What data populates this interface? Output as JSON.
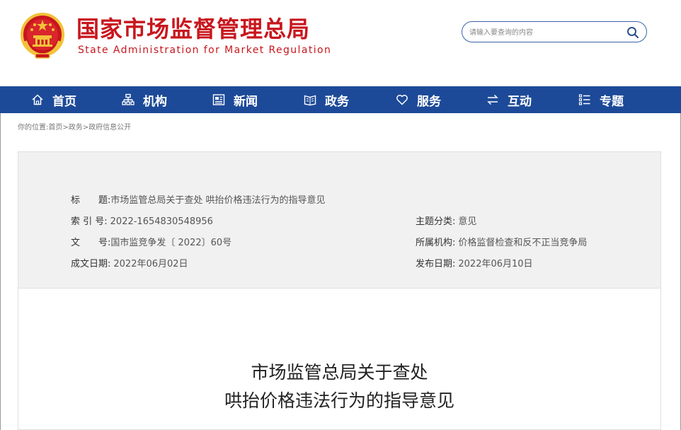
{
  "header": {
    "title": "国家市场监督管理总局",
    "subtitle": "State Administration for Market Regulation",
    "search": {
      "placeholder": "请输入要查询的内容"
    }
  },
  "nav": {
    "items": [
      {
        "label": "首页",
        "icon": "home-icon"
      },
      {
        "label": "机构",
        "icon": "org-chart-icon"
      },
      {
        "label": "新闻",
        "icon": "newspaper-icon"
      },
      {
        "label": "政务",
        "icon": "open-book-icon"
      },
      {
        "label": "服务",
        "icon": "heart-icon"
      },
      {
        "label": "互动",
        "icon": "exchange-arrows-icon"
      },
      {
        "label": "专题",
        "icon": "list-icon"
      }
    ]
  },
  "breadcrumb": {
    "prefix": "你的位置:",
    "items": [
      "首页",
      "政务",
      "政府信息公开"
    ],
    "separator": ">"
  },
  "meta": {
    "title_label": "标　　题:",
    "title_value": "市场监管总局关于查处 哄抬价格违法行为的指导意见",
    "index_label": "索 引 号:",
    "index_value": "2022-1654830548956",
    "category_label": "主题分类:",
    "category_value": "意见",
    "doc_no_label": "文　　号:",
    "doc_no_value": "国市监竞争发〔 2022〕60号",
    "agency_label": "所属机构:",
    "agency_value": "价格监督检查和反不正当竞争局",
    "created_label": "成文日期:",
    "created_value": "2022年06月02日",
    "published_label": "发布日期:",
    "published_value": "2022年06月10日"
  },
  "document": {
    "title_line1": "市场监管总局关于查处",
    "title_line2": "哄抬价格违法行为的指导意见"
  },
  "colors": {
    "brand_red": "#c8161d",
    "nav_blue": "#1d4a98",
    "emblem_gold": "#f2c23a"
  }
}
